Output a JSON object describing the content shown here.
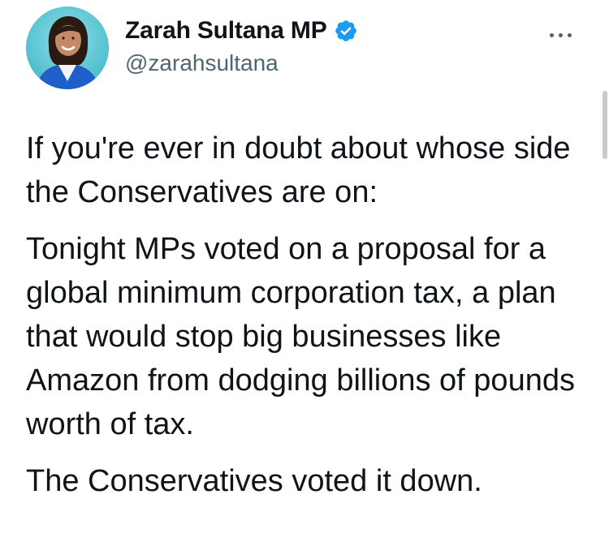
{
  "author": {
    "display_name": "Zarah Sultana MP",
    "handle": "@zarahsultana",
    "verified": true,
    "avatar_icon": "person-avatar",
    "verified_icon": "verified-badge-icon"
  },
  "menu": {
    "icon": "more-options-icon"
  },
  "tweet": {
    "paragraphs": [
      "If you're ever in doubt about whose side the Conservatives are on:",
      "Tonight MPs voted on a proposal for a global minimum corporation tax, a plan that would stop big businesses like Amazon from dodging billions of pounds worth of tax.",
      "The Conservatives voted it down."
    ]
  },
  "colors": {
    "text": "#0f1419",
    "secondary_text": "#536471",
    "verified_blue": "#1d9bf0",
    "avatar_background": "#5ec8d6",
    "jacket_blue": "#1f5fc9"
  }
}
